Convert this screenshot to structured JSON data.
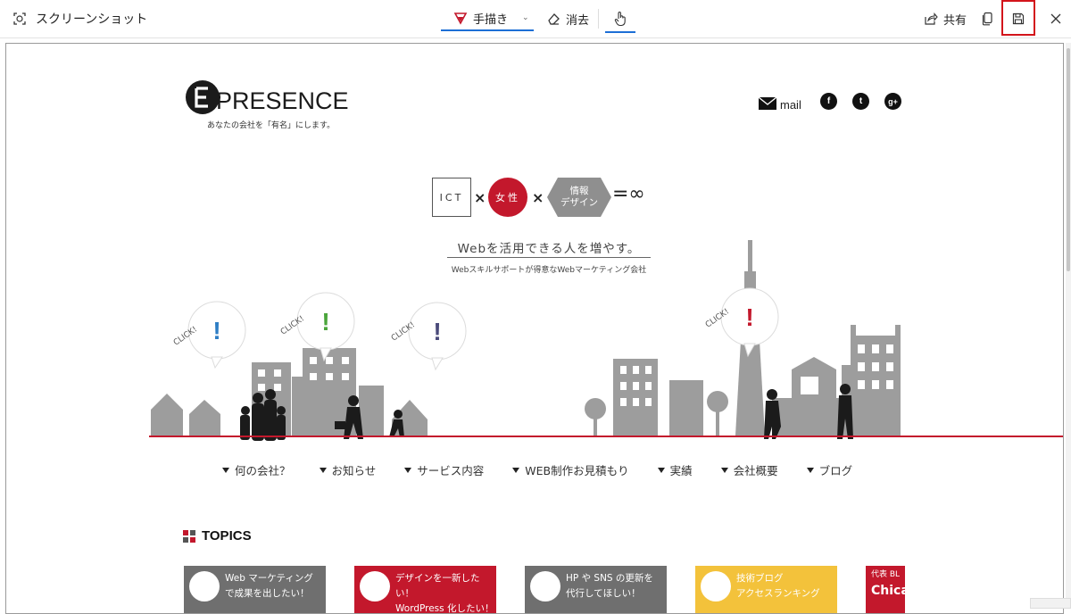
{
  "toolbar": {
    "app_title": "スクリーンショット",
    "pen_label": "手描き",
    "eraser_label": "消去",
    "share_label": "共有"
  },
  "site": {
    "logo_text": "PRESENCE",
    "tagline": "あなたの会社を「有名」にします。",
    "mail_label": "mail",
    "sns": [
      "f",
      "t",
      "g+"
    ],
    "ict": "ICT",
    "times": "×",
    "josei": "女性",
    "jouhou_1": "情報",
    "jouhou_2": "デザイン",
    "equals_inf": "=∞",
    "catch": "Webを活用できる人を増やす。",
    "catch_sub": "Webスキルサポートが得意なWebマーケティング会社",
    "click": "CLICK!",
    "nav": [
      "何の会社？",
      "お知らせ",
      "サービス内容",
      "WEB制作お見積もり",
      "実績",
      "会社概要",
      "ブログ"
    ],
    "topics_label": "TOPICS",
    "cards": [
      {
        "line1": "Web マーケティング",
        "line2": "で成果を出したい！",
        "color": "#6f6f6f"
      },
      {
        "line1": "デザインを一新したい！",
        "line2": "WordPress 化したい！",
        "color": "#c3182c"
      },
      {
        "line1": "HP や SNS の更新を",
        "line2": "代行してほしい！",
        "color": "#6f6f6f"
      },
      {
        "line1": "技術ブログ",
        "line2": "アクセスランキング",
        "color": "#f3c23b"
      },
      {
        "line1": "代表 BL",
        "line2": "Chica",
        "color": "#c3182c"
      }
    ]
  },
  "colors": {
    "accent_red": "#c3182c",
    "building_gray": "#9d9d9d",
    "toolbar_blue": "#1d6fd6"
  }
}
